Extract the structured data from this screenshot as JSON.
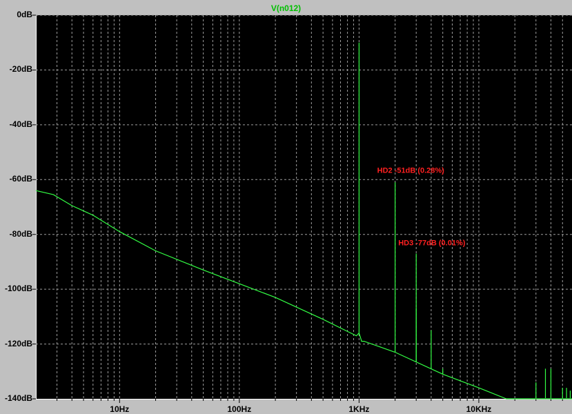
{
  "window": {
    "trace_label": "V(n012)"
  },
  "colors": {
    "background": "#000000",
    "trace": "#33ff44",
    "grid": "#a0a0a0",
    "annotation": "#ff2020",
    "window": "#c0c0c0"
  },
  "chart_data": {
    "type": "line",
    "title": "V(n012)",
    "x_scale": "log",
    "xlim": [
      2,
      60000
    ],
    "ylim": [
      -140,
      0
    ],
    "grid": true,
    "y_ticks": [
      "0dB",
      "-20dB",
      "-40dB",
      "-60dB",
      "-80dB",
      "-100dB",
      "-120dB",
      "-140dB"
    ],
    "y_tick_values": [
      0,
      -20,
      -40,
      -60,
      -80,
      -100,
      -120,
      -140
    ],
    "x_ticks": [
      "10Hz",
      "100Hz",
      "1KHz",
      "10KHz"
    ],
    "x_tick_values": [
      10,
      100,
      1000,
      10000
    ],
    "series": [
      {
        "name": "V(n012)",
        "noise_floor": [
          [
            2,
            -64
          ],
          [
            2.8,
            -65.5
          ],
          [
            4,
            -69.5
          ],
          [
            6,
            -73
          ],
          [
            10,
            -79
          ],
          [
            20,
            -86
          ],
          [
            50,
            -93
          ],
          [
            100,
            -98
          ],
          [
            200,
            -103
          ],
          [
            500,
            -111
          ],
          [
            950,
            -117
          ],
          [
            1000,
            -116
          ],
          [
            1050,
            -119
          ],
          [
            1100,
            -119
          ],
          [
            2000,
            -123
          ],
          [
            5000,
            -131
          ],
          [
            10000,
            -136
          ],
          [
            17000,
            -140
          ],
          [
            60000,
            -140
          ]
        ],
        "peaks": [
          {
            "x": 1000,
            "y": -10
          },
          {
            "x": 2000,
            "y": -61
          },
          {
            "x": 3000,
            "y": -87
          },
          {
            "x": 3000,
            "y": -107
          },
          {
            "x": 4000,
            "y": -115
          },
          {
            "x": 5000,
            "y": -129
          },
          {
            "x": 30000,
            "y": -134
          },
          {
            "x": 36000,
            "y": -129
          },
          {
            "x": 40000,
            "y": -129
          },
          {
            "x": 50000,
            "y": -136
          },
          {
            "x": 54000,
            "y": -136
          },
          {
            "x": 58000,
            "y": -137
          }
        ]
      }
    ],
    "annotations": [
      {
        "text": "HD2 -51dB (0.28%)",
        "x": 2000,
        "y": -57.5
      },
      {
        "text": "HD3 -77dB (0.01%)",
        "x": 3000,
        "y": -84
      }
    ]
  }
}
